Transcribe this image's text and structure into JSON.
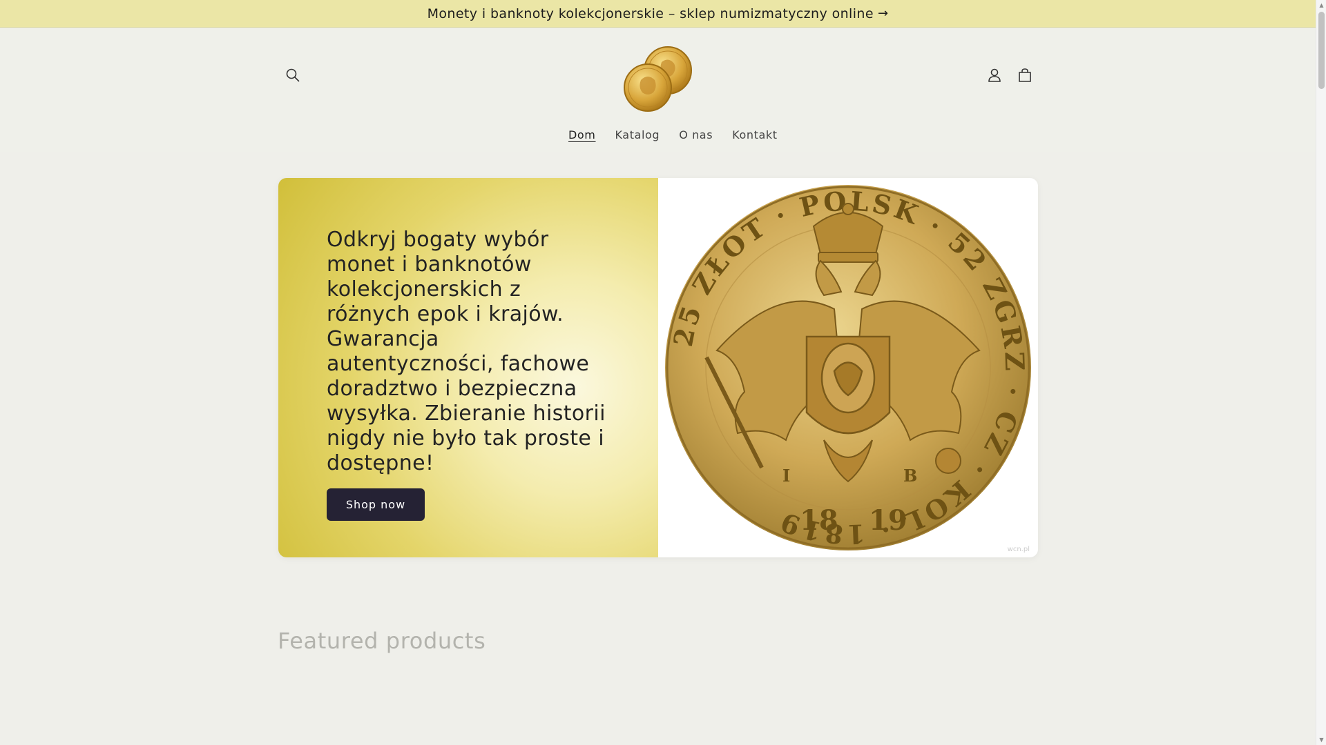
{
  "announcement": {
    "text": "Monety i banknoty kolekcjonerskie – sklep numizmatyczny online",
    "arrow": "→"
  },
  "header": {
    "icons": {
      "search": "search-icon",
      "account": "account-icon",
      "cart": "cart-icon"
    },
    "logo": "gold-coins-logo"
  },
  "nav": {
    "items": [
      {
        "label": "Dom",
        "active": true
      },
      {
        "label": "Katalog",
        "active": false
      },
      {
        "label": "O nas",
        "active": false
      },
      {
        "label": "Kontakt",
        "active": false
      }
    ]
  },
  "hero": {
    "heading": "Odkryj bogaty wybór monet i banknotów kolekcjonerskich z różnych epok i krajów. Gwarancja autentyczności, fachowe doradztwo i bezpieczna wysyłka. Zbieranie historii nigdy nie było tak proste i dostępne!",
    "button_label": "Shop now",
    "coin": {
      "legend": "25 ZŁOT · POLSK · 52 ZGRZ · CZ · KOL · 1819",
      "mint_left": "I",
      "mint_right": "B",
      "year_left": "18",
      "year_right": "19",
      "watermark": "wcn.pl"
    }
  },
  "featured": {
    "title": "Featured products"
  },
  "colors": {
    "announcement_bg": "#ebe6a6",
    "page_bg": "#efefea",
    "hero_gold": "#d1bf3a",
    "button_bg": "#252234"
  }
}
